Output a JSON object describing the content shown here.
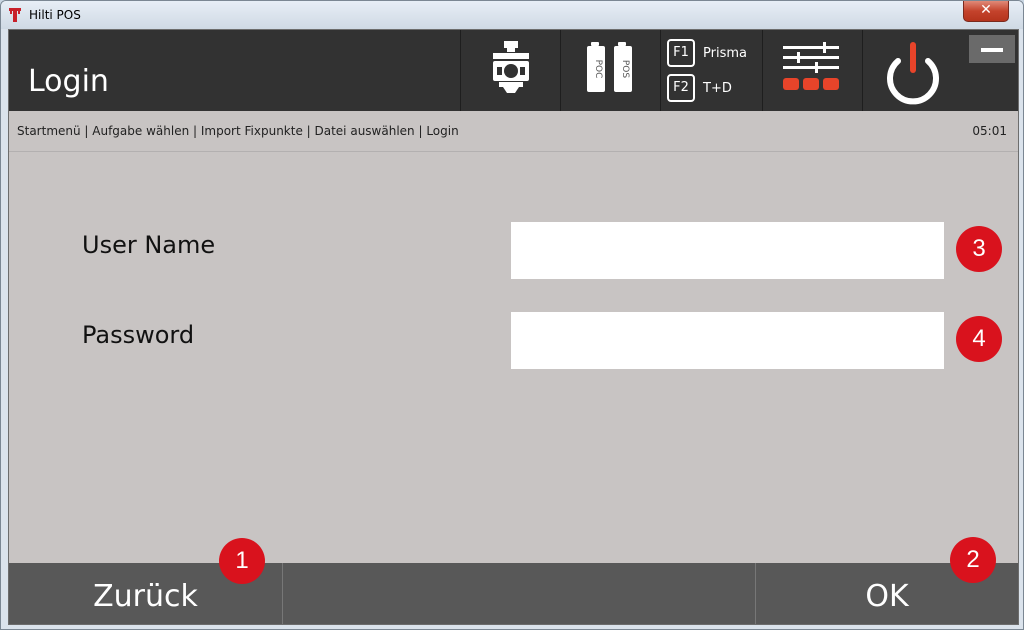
{
  "window": {
    "title": "Hilti POS",
    "close_symbol": "✕"
  },
  "header": {
    "title": "Login",
    "fkeys": [
      {
        "key": "F1",
        "label": "Prisma"
      },
      {
        "key": "F2",
        "label": "T+D"
      }
    ],
    "battery_labels": [
      "POC",
      "POS"
    ],
    "icons": [
      "instrument-icon",
      "battery-icon",
      "settings-icon",
      "power-icon"
    ]
  },
  "breadcrumb": {
    "path": "Startmenü | Aufgabe wählen | Import Fixpunkte | Datei auswählen | Login",
    "time": "05:01"
  },
  "form": {
    "username": {
      "label": "User Name",
      "value": "",
      "badge": "3"
    },
    "password": {
      "label": "Password",
      "value": "",
      "badge": "4"
    }
  },
  "footer": {
    "back": {
      "label": "Zurück",
      "badge": "1"
    },
    "ok": {
      "label": "OK",
      "badge": "2"
    }
  },
  "colors": {
    "accent": "#e8442a",
    "badge": "#d9121d",
    "header": "#323232",
    "background": "#c8c4c3"
  }
}
